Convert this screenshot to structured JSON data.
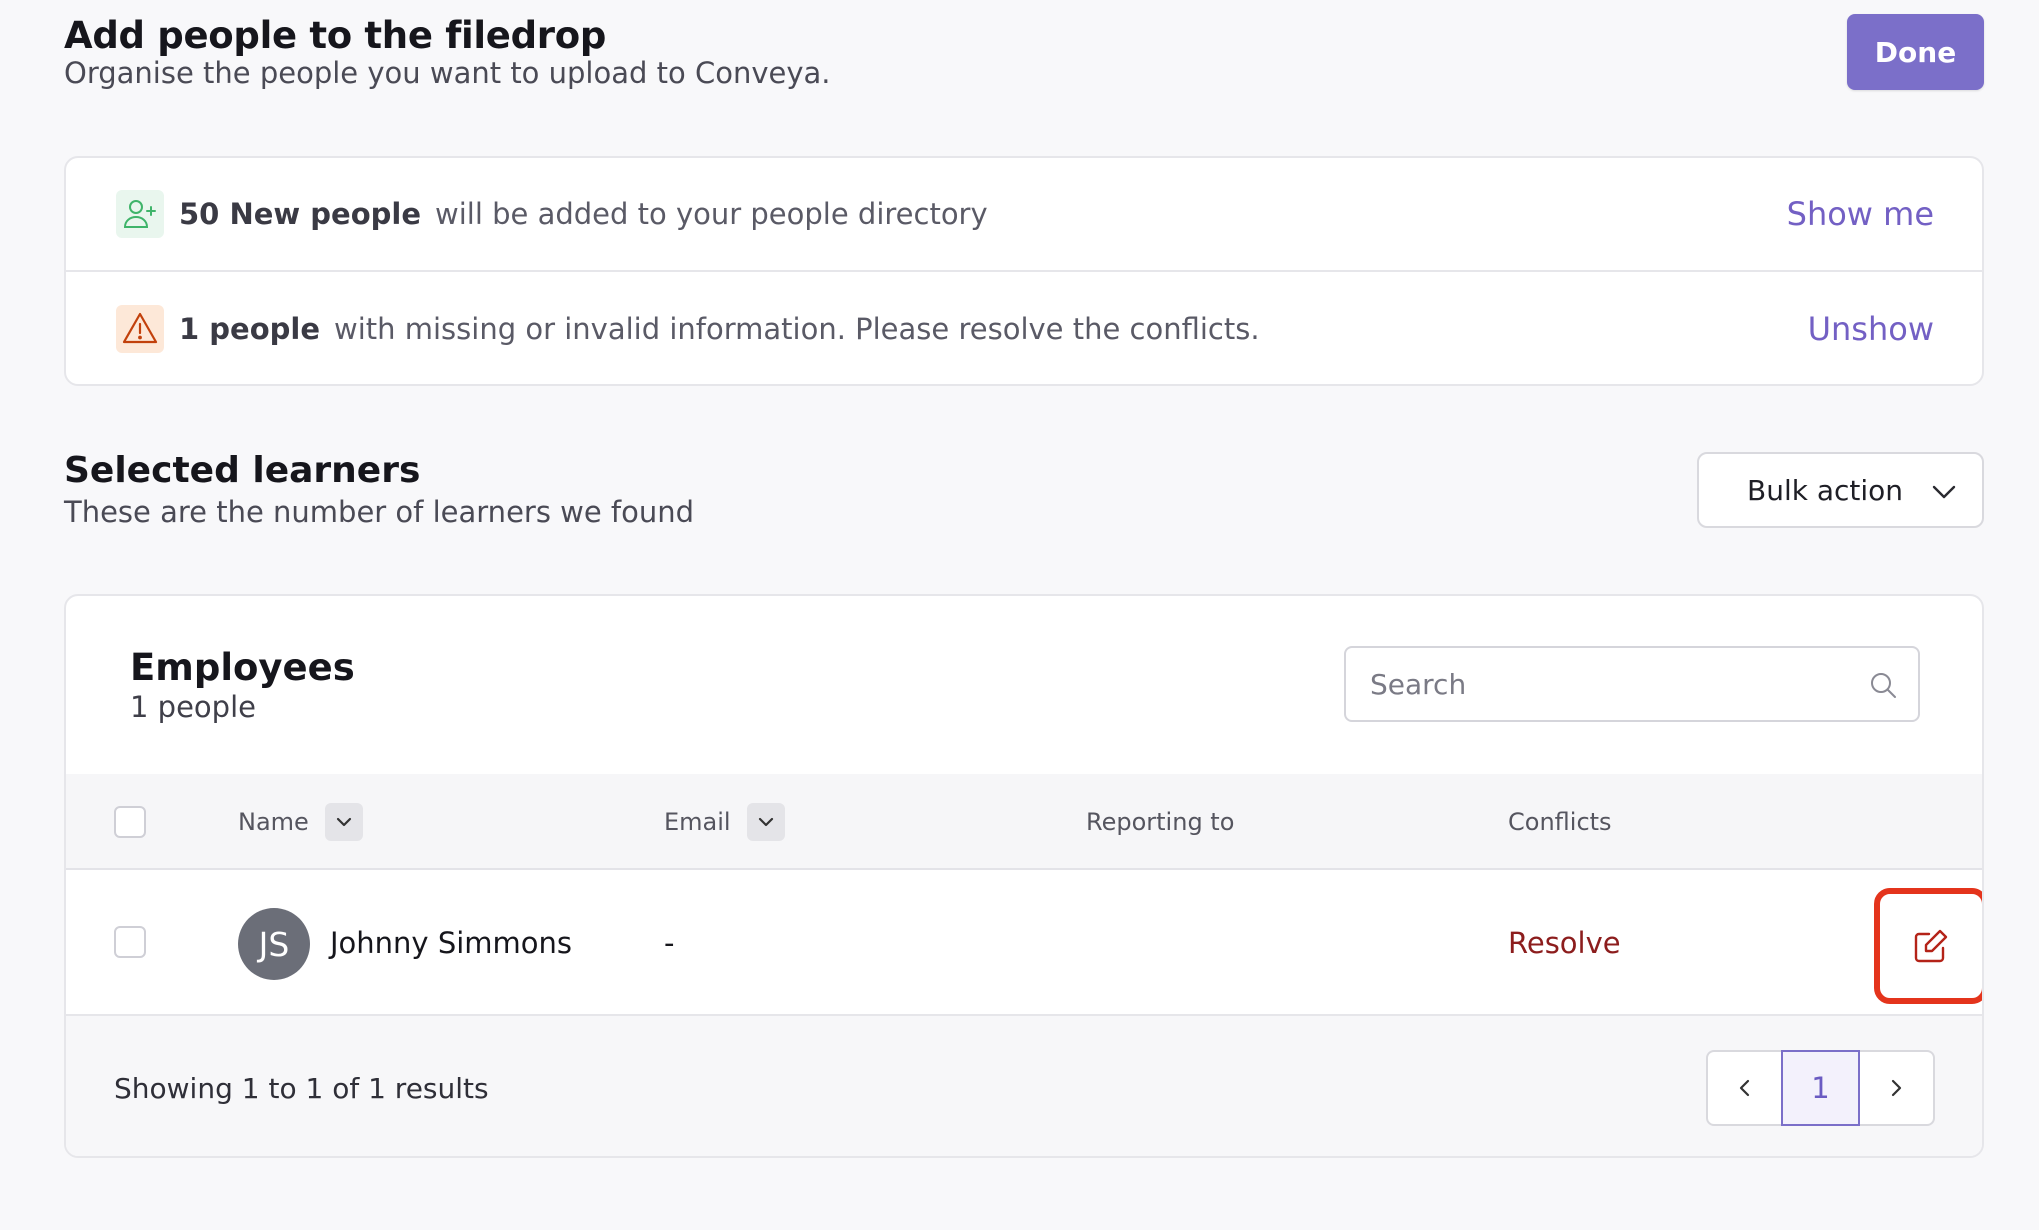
{
  "header": {
    "title": "Add people to the filedrop",
    "subtitle": "Organise the people you want to upload to Conveya.",
    "done_label": "Done"
  },
  "notices": [
    {
      "icon": "user-plus-icon",
      "bold": "50 New people",
      "text": "will be added to your people directory",
      "link": "Show me"
    },
    {
      "icon": "warning-triangle-icon",
      "bold": "1 people",
      "text": "with missing or invalid information. Please resolve the conflicts.",
      "link": "Unshow"
    }
  ],
  "learners": {
    "title": "Selected learners",
    "subtitle": "These are the number of learners we found",
    "bulk_action_label": "Bulk action"
  },
  "employees": {
    "title": "Employees",
    "count": "1 people",
    "search_placeholder": "Search",
    "columns": {
      "name": "Name",
      "email": "Email",
      "reporting_to": "Reporting to",
      "conflicts": "Conflicts"
    },
    "rows": [
      {
        "initials": "JS",
        "name": "Johnny Simmons",
        "email": "-",
        "reporting_to": "",
        "conflict": "Resolve"
      }
    ],
    "results_text": "Showing 1 to 1 of 1 results",
    "current_page": "1"
  },
  "colors": {
    "accent": "#7b6fc9",
    "conflict": "#8c1d1d",
    "highlight": "#e4341c"
  }
}
